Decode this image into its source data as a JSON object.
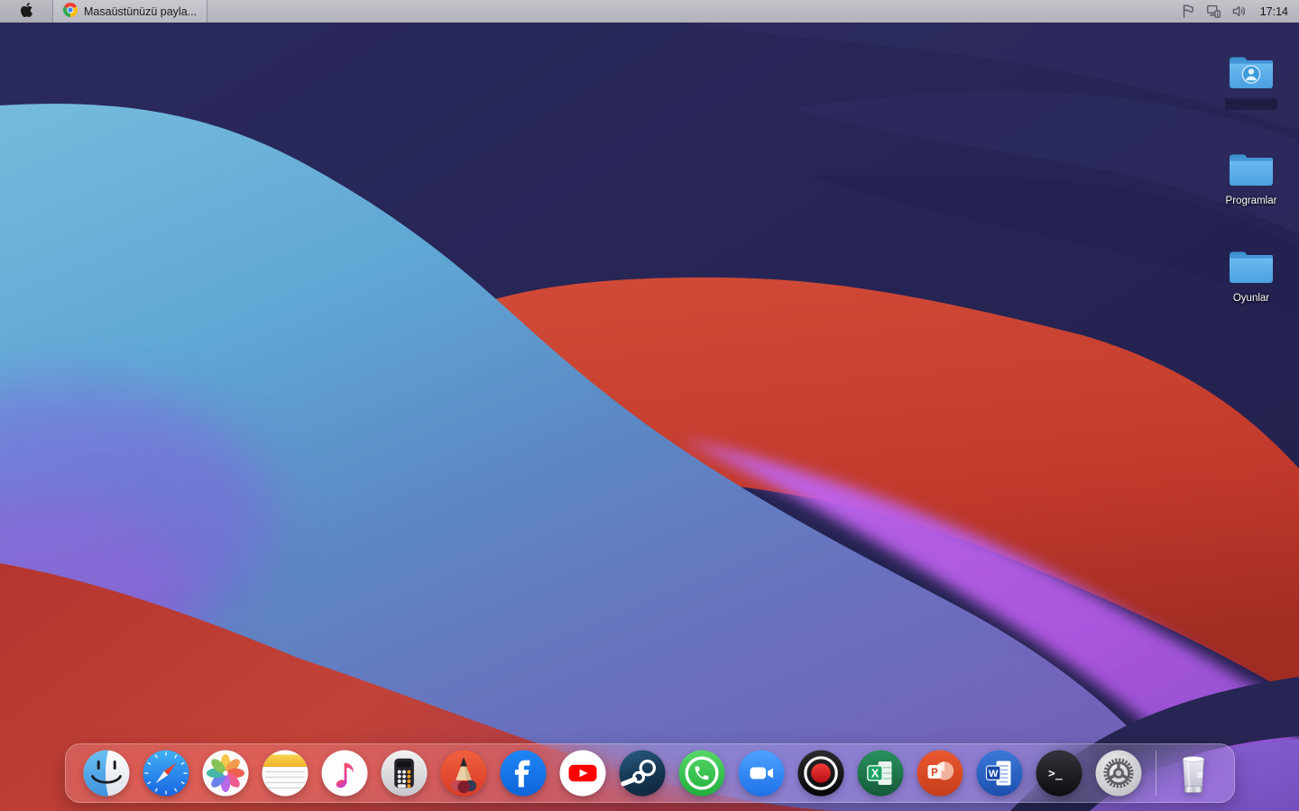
{
  "menubar": {
    "left_icon": "apple-logo-icon",
    "app_tab": {
      "icon": "chrome-icon",
      "title": "Masaüstünüzü payla..."
    },
    "tray": {
      "icons": [
        "flag-icon",
        "network-icon",
        "speaker-icon"
      ],
      "clock": "17:14"
    }
  },
  "desktop": {
    "wallpaper": "macos-big-sur-waves",
    "icons": [
      {
        "id": "user-folder",
        "icon": "folder-user-icon",
        "label": "",
        "selected": true
      },
      {
        "id": "programlar",
        "icon": "folder-icon",
        "label": "Programlar",
        "selected": false
      },
      {
        "id": "oyunlar",
        "icon": "folder-icon",
        "label": "Oyunlar",
        "selected": false
      }
    ]
  },
  "dock": {
    "items": [
      {
        "icon": "finder-icon"
      },
      {
        "icon": "safari-icon"
      },
      {
        "icon": "photos-icon"
      },
      {
        "icon": "notes-icon"
      },
      {
        "icon": "music-icon"
      },
      {
        "icon": "calculator-icon"
      },
      {
        "icon": "sketch-icon"
      },
      {
        "icon": "facebook-icon"
      },
      {
        "icon": "youtube-icon"
      },
      {
        "icon": "steam-icon"
      },
      {
        "icon": "whatsapp-icon"
      },
      {
        "icon": "zoom-icon"
      },
      {
        "icon": "record-icon"
      },
      {
        "icon": "excel-icon"
      },
      {
        "icon": "powerpoint-icon"
      },
      {
        "icon": "word-icon"
      },
      {
        "icon": "terminal-icon"
      },
      {
        "icon": "settings-icon"
      }
    ],
    "trash": {
      "icon": "trash-icon"
    }
  },
  "colors": {
    "menubar_bg": "#b9bac1",
    "wallpaper_navy": "#232250",
    "wallpaper_teal": "#63a9d4",
    "wallpaper_red": "#c0392c",
    "wallpaper_magenta": "#b55ce0",
    "folder_blue": "#57ade8",
    "dock_bg": "rgba(250,235,242,0.20)"
  }
}
